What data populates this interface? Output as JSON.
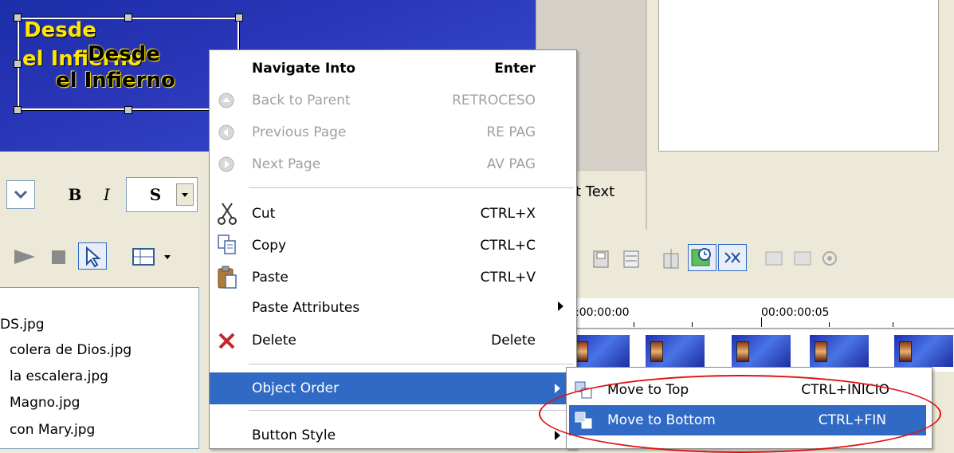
{
  "canvas": {
    "title_line1": "Desde",
    "title_line2": "el Infierno",
    "ghost_line1": "Desde",
    "ghost_line2": "el Infierno"
  },
  "format_toolbar": {
    "bold_label": "B",
    "italic_label": "I",
    "shadow_label": "S"
  },
  "timeline": {
    "tab_fragment": "t Text",
    "ruler_marks": [
      ":00:00:00",
      "00:00:00:05"
    ]
  },
  "file_list": {
    "items": [
      "DS.jpg",
      "colera de Dios.jpg",
      "la escalera.jpg",
      "Magno.jpg",
      "con Mary.jpg"
    ]
  },
  "context_menu": {
    "items": [
      {
        "label": "Navigate Into",
        "shortcut": "Enter"
      },
      {
        "label": "Back to Parent",
        "shortcut": "RETROCESO"
      },
      {
        "label": "Previous Page",
        "shortcut": "RE PAG"
      },
      {
        "label": "Next Page",
        "shortcut": "AV PAG"
      },
      {
        "label": "Cut",
        "shortcut": "CTRL+X"
      },
      {
        "label": "Copy",
        "shortcut": "CTRL+C"
      },
      {
        "label": "Paste",
        "shortcut": "CTRL+V"
      },
      {
        "label": "Paste Attributes",
        "shortcut": ""
      },
      {
        "label": "Delete",
        "shortcut": "Delete"
      },
      {
        "label": "Object Order",
        "shortcut": ""
      },
      {
        "label": "Button Style",
        "shortcut": ""
      }
    ]
  },
  "submenu": {
    "items": [
      {
        "label": "Move to Top",
        "shortcut": "CTRL+INICIO"
      },
      {
        "label": "Move to Bottom",
        "shortcut": "CTRL+FIN"
      }
    ]
  },
  "colors": {
    "highlight": "#316ac5",
    "annotation_circle": "#e01010",
    "canvas_blue": "#2a36b8",
    "title_yellow": "#ffe600"
  },
  "icons": [
    "scissors-icon",
    "copy-icon",
    "paste-icon",
    "delete-x-icon",
    "move-to-top-icon",
    "move-to-bottom-icon"
  ]
}
